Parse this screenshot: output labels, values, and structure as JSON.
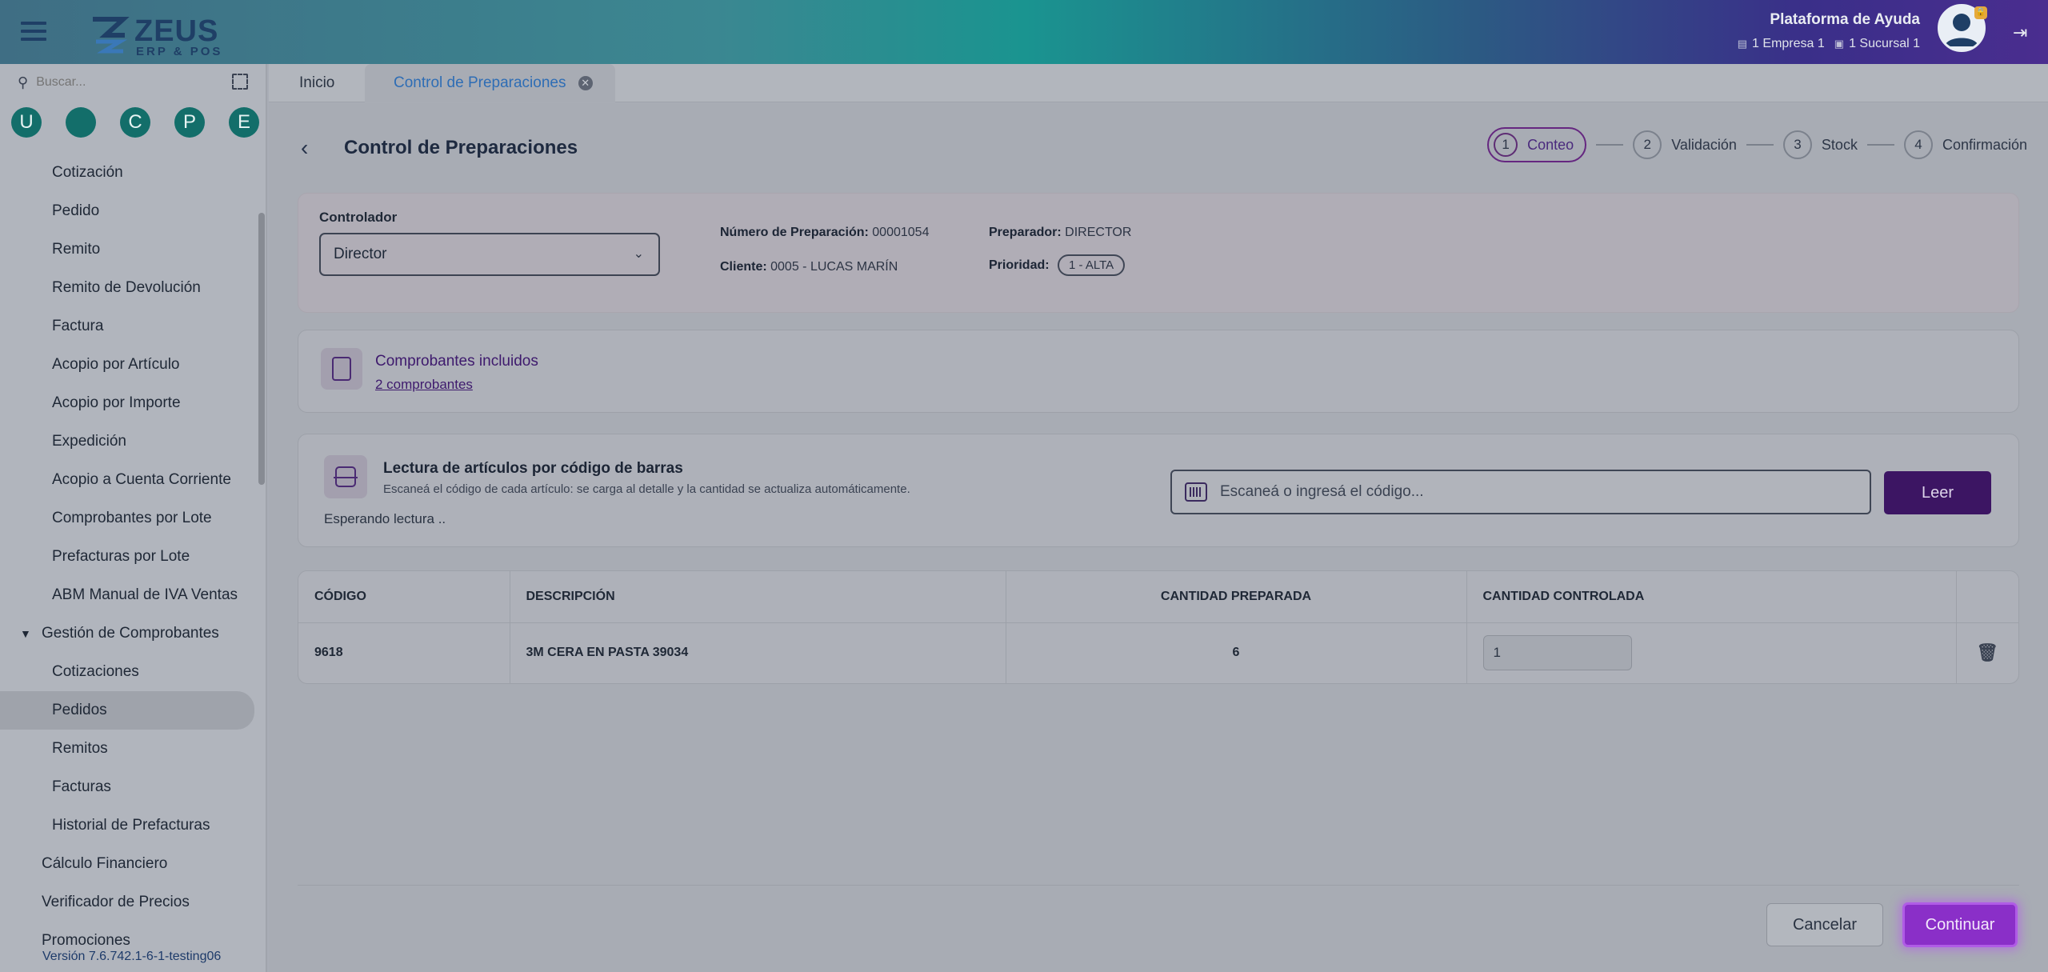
{
  "app": {
    "logo_main": "ZEUS",
    "logo_sub": "ERP & POS",
    "help_title": "Plataforma de Ayuda",
    "company": "1 Empresa 1",
    "branch": "1 Sucursal 1"
  },
  "sidebar": {
    "search_placeholder": "Buscar...",
    "letters": [
      "U",
      "",
      "C",
      "P",
      "E"
    ],
    "items": [
      {
        "label": "Cotización"
      },
      {
        "label": "Pedido"
      },
      {
        "label": "Remito"
      },
      {
        "label": "Remito de Devolución"
      },
      {
        "label": "Factura"
      },
      {
        "label": "Acopio por Artículo"
      },
      {
        "label": "Acopio por Importe"
      },
      {
        "label": "Expedición"
      },
      {
        "label": "Acopio a Cuenta Corriente"
      },
      {
        "label": "Comprobantes por Lote"
      },
      {
        "label": "Prefacturas por Lote"
      },
      {
        "label": "ABM Manual de IVA Ventas"
      }
    ],
    "group_label": "Gestión de Comprobantes",
    "group_items": [
      {
        "label": "Cotizaciones"
      },
      {
        "label": "Pedidos"
      },
      {
        "label": "Remitos"
      },
      {
        "label": "Facturas"
      },
      {
        "label": "Historial de Prefacturas"
      }
    ],
    "top_items": [
      {
        "label": "Cálculo Financiero"
      },
      {
        "label": "Verificador de Precios"
      },
      {
        "label": "Promociones"
      }
    ],
    "version": "Versión 7.6.742.1-6-1-testing06"
  },
  "tabs": {
    "home": "Inicio",
    "active": "Control de Preparaciones"
  },
  "page": {
    "title": "Control de Preparaciones",
    "steps": [
      {
        "num": "1",
        "label": "Conteo"
      },
      {
        "num": "2",
        "label": "Validación"
      },
      {
        "num": "3",
        "label": "Stock"
      },
      {
        "num": "4",
        "label": "Confirmación"
      }
    ],
    "controller": {
      "label": "Controlador",
      "value": "Director"
    },
    "info": {
      "prep_number_label": "Número de Preparación:",
      "prep_number_value": "00001054",
      "client_label": "Cliente:",
      "client_value": "0005 - LUCAS MARÍN",
      "preparer_label": "Preparador:",
      "preparer_value": "DIRECTOR",
      "priority_label": "Prioridad:",
      "priority_value": "1 - ALTA"
    },
    "vouchers": {
      "title": "Comprobantes incluidos",
      "link": "2 comprobantes"
    },
    "barcode": {
      "title": "Lectura de artículos por código de barras",
      "subtitle": "Escaneá el código de cada artículo: se carga al detalle y la cantidad se actualiza automáticamente.",
      "status": "Esperando lectura  ..",
      "placeholder": "Escaneá o ingresá el código...",
      "button": "Leer"
    },
    "table": {
      "headers": [
        "CÓDIGO",
        "DESCRIPCIÓN",
        "CANTIDAD PREPARADA",
        "CANTIDAD CONTROLADA"
      ],
      "rows": [
        {
          "code": "9618",
          "description": "3M CERA EN PASTA 39034",
          "prepared": "6",
          "controlled": "1"
        }
      ]
    },
    "buttons": {
      "cancel": "Cancelar",
      "continue": "Continuar"
    }
  }
}
